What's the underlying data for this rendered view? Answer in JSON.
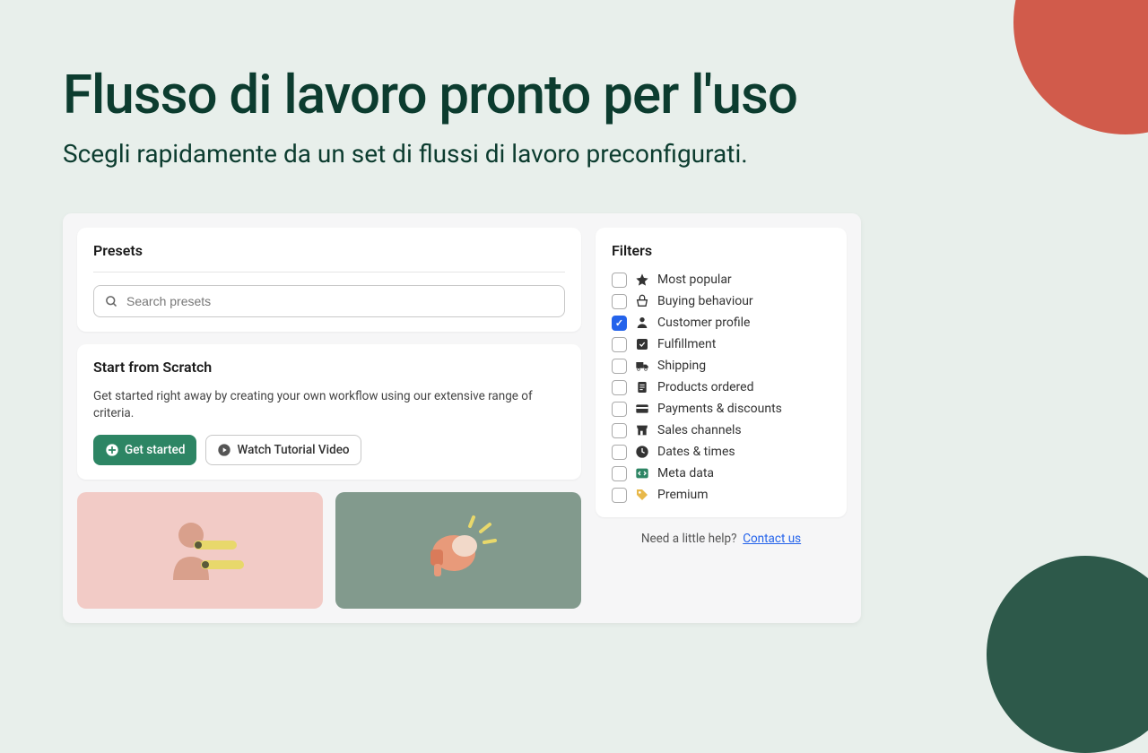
{
  "hero": {
    "title": "Flusso di lavoro pronto per l'uso",
    "subtitle": "Scegli rapidamente da un set di flussi di lavoro preconfigurati."
  },
  "presets": {
    "heading": "Presets",
    "search_placeholder": "Search presets"
  },
  "scratch": {
    "heading": "Start from Scratch",
    "description": "Get started right away by creating your own workflow using our extensive range of criteria.",
    "get_started_label": "Get started",
    "watch_video_label": "Watch Tutorial Video"
  },
  "filters": {
    "heading": "Filters",
    "items": [
      {
        "label": "Most popular",
        "checked": false,
        "icon": "star"
      },
      {
        "label": "Buying behaviour",
        "checked": false,
        "icon": "basket"
      },
      {
        "label": "Customer profile",
        "checked": true,
        "icon": "person"
      },
      {
        "label": "Fulfillment",
        "checked": false,
        "icon": "box-check"
      },
      {
        "label": "Shipping",
        "checked": false,
        "icon": "truck"
      },
      {
        "label": "Products ordered",
        "checked": false,
        "icon": "receipt"
      },
      {
        "label": "Payments & discounts",
        "checked": false,
        "icon": "card"
      },
      {
        "label": "Sales channels",
        "checked": false,
        "icon": "store"
      },
      {
        "label": "Dates & times",
        "checked": false,
        "icon": "clock"
      },
      {
        "label": "Meta data",
        "checked": false,
        "icon": "code"
      },
      {
        "label": "Premium",
        "checked": false,
        "icon": "tag"
      }
    ]
  },
  "help": {
    "text": "Need a little help?",
    "link_label": "Contact us"
  }
}
